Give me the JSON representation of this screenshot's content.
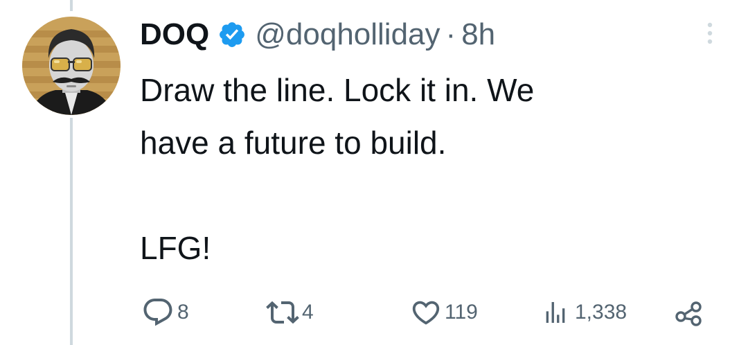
{
  "author": {
    "display_name": "DOQ",
    "handle": "@doqholliday",
    "separator": "·",
    "time": "8h",
    "verified": true,
    "avatar_icon": "avatar-man-sunglasses-mustache"
  },
  "tweet": {
    "text": "Draw the line. Lock it in. We\nhave a future to build.\n\nLFG!"
  },
  "actions": {
    "reply_count": "8",
    "retweet_count": "4",
    "like_count": "119",
    "views_count": "1,338"
  },
  "icons": {
    "more": "more-vertical-icon",
    "reply": "reply-icon",
    "retweet": "retweet-icon",
    "like": "heart-icon",
    "views": "views-icon",
    "share": "share-icon",
    "verified": "verified-badge-icon"
  },
  "colors": {
    "text": "#0f1419",
    "secondary": "#536471",
    "verified": "#1d9bf0",
    "thread_line": "#cfd9de"
  }
}
